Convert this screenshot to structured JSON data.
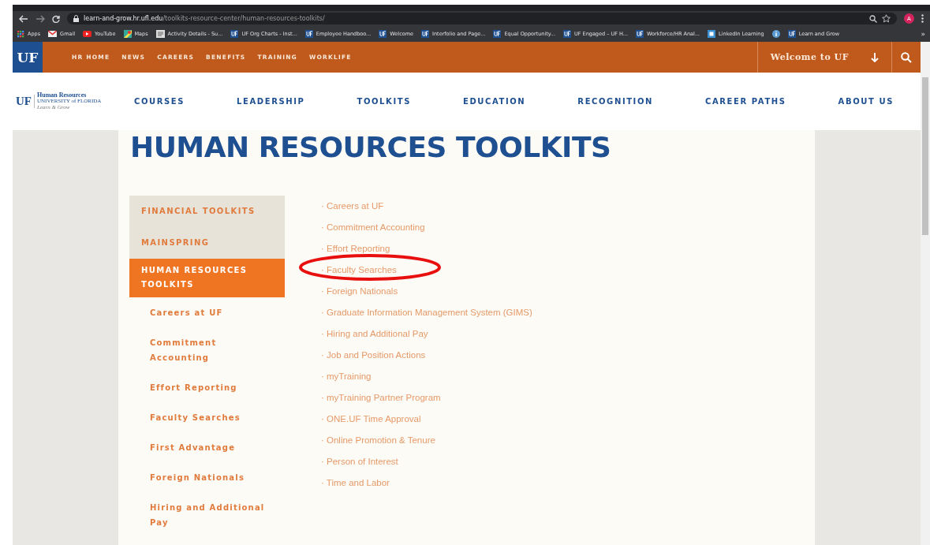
{
  "browser": {
    "url_host": "learn-and-grow.hr.ufl.edu",
    "url_path": "/toolkits-resource-center/human-resources-toolkits/",
    "avatar": "A",
    "bookmarks": [
      {
        "label": "Apps",
        "kind": "apps"
      },
      {
        "label": "Gmail",
        "kind": "mail"
      },
      {
        "label": "YouTube",
        "kind": "video"
      },
      {
        "label": "Maps",
        "kind": "map"
      },
      {
        "label": "Activity Details - Su...",
        "kind": "doc"
      },
      {
        "label": "UF Org Charts - Inst...",
        "kind": "uf"
      },
      {
        "label": "Employee Handboo...",
        "kind": "uf"
      },
      {
        "label": "Welcome",
        "kind": "uf"
      },
      {
        "label": "Interfolio and Page...",
        "kind": "uf"
      },
      {
        "label": "Equal Opportunity...",
        "kind": "uf"
      },
      {
        "label": "UF Engaged – UF H...",
        "kind": "uf"
      },
      {
        "label": "Workforce/HR Anal...",
        "kind": "uf"
      },
      {
        "label": "LinkedIn Learning",
        "kind": "square"
      },
      {
        "kind": "info"
      },
      {
        "label": "Learn and Grow",
        "kind": "uf"
      }
    ],
    "more": "»"
  },
  "topbar": {
    "logo": "UF",
    "links": [
      "HR HOME",
      "NEWS",
      "CAREERS",
      "BENEFITS",
      "TRAINING",
      "WORKLIFE"
    ],
    "welcome": "Welcome to UF"
  },
  "site_logo": {
    "mark": "UF",
    "line_1": "Human Resources",
    "line_2": "UNIVERSITY of FLORIDA",
    "line_3": "Learn & Grow"
  },
  "main_nav": [
    "COURSES",
    "LEADERSHIP",
    "TOOLKITS",
    "EDUCATION",
    "RECOGNITION",
    "CAREER PATHS",
    "ABOUT US"
  ],
  "page_title": "HUMAN RESOURCES TOOLKITS",
  "sidebar": {
    "sections": [
      {
        "label": "FINANCIAL TOOLKITS",
        "selected": false
      },
      {
        "label": "MAINSPRING",
        "selected": false
      },
      {
        "label": "HUMAN RESOURCES TOOLKITS",
        "selected": true
      }
    ],
    "sub_items": [
      "Careers at UF",
      "Commitment Accounting",
      "Effort Reporting",
      "Faculty Searches",
      "First Advantage",
      "Foreign Nationals",
      "Hiring and Additional Pay"
    ]
  },
  "toolkit_links": [
    {
      "label": "· Careers at UF",
      "circled": false
    },
    {
      "label": "· Commitment Accounting",
      "circled": false
    },
    {
      "label": "· Effort Reporting",
      "circled": false
    },
    {
      "label": "· Faculty Searches",
      "circled": true
    },
    {
      "label": "· Foreign Nationals",
      "circled": false
    },
    {
      "label": "· Graduate Information Management System (GIMS)",
      "circled": false
    },
    {
      "label": "· Hiring and Additional Pay",
      "circled": false
    },
    {
      "label": "· Job and Position Actions",
      "circled": false
    },
    {
      "label": "· myTraining",
      "circled": false
    },
    {
      "label": "· myTraining Partner Program",
      "circled": false
    },
    {
      "label": "· ONE.UF Time Approval",
      "circled": false
    },
    {
      "label": "· Online Promotion & Tenure",
      "circled": false
    },
    {
      "label": "· Person of Interest",
      "circled": false
    },
    {
      "label": "· Time and Labor",
      "circled": false
    }
  ]
}
